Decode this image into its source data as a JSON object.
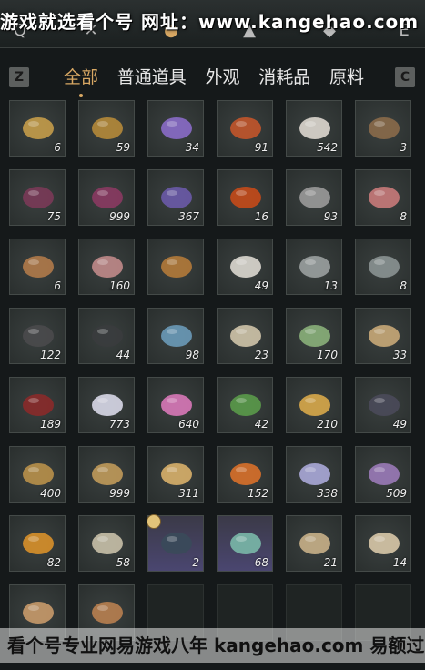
{
  "watermark_top": "游戏就选看个号   网址：www.kangehao.com",
  "watermark_bottom": "看个号专业网易游戏八年  kangehao.com  易额过百亿",
  "keys": {
    "left": "Z",
    "right": "C",
    "top_left": "Q",
    "top_right": "E"
  },
  "tabs": [
    {
      "label": "全部",
      "active": true
    },
    {
      "label": "普通道具",
      "active": false
    },
    {
      "label": "外观",
      "active": false
    },
    {
      "label": "消耗品",
      "active": false
    },
    {
      "label": "原料",
      "active": false
    }
  ],
  "items": [
    {
      "name": "fish-gold",
      "count": "6",
      "color": "#c49c4a"
    },
    {
      "name": "ore-gold",
      "count": "59",
      "color": "#b58a3a"
    },
    {
      "name": "crystal-purple",
      "count": "34",
      "color": "#8a6bc8"
    },
    {
      "name": "stone-red",
      "count": "91",
      "color": "#c2552b"
    },
    {
      "name": "herb-white",
      "count": "542",
      "color": "#ddd7cf"
    },
    {
      "name": "mortar-bowl",
      "count": "3",
      "color": "#8a6a4a"
    },
    {
      "name": "flower-purple",
      "count": "75",
      "color": "#7a3a58"
    },
    {
      "name": "flower-purple-2",
      "count": "999",
      "color": "#8a3a62"
    },
    {
      "name": "lavender",
      "count": "367",
      "color": "#6a5aa8"
    },
    {
      "name": "red-flower",
      "count": "16",
      "color": "#c44a1a"
    },
    {
      "name": "grass-gray",
      "count": "93",
      "color": "#9a9a9a"
    },
    {
      "name": "meat-slices",
      "count": "8",
      "color": "#c87a7a"
    },
    {
      "name": "bowl-soup",
      "count": "6",
      "color": "#b07a4a"
    },
    {
      "name": "meat-plate",
      "count": "160",
      "color": "#c08a8a"
    },
    {
      "name": "hide-brown",
      "count": "",
      "color": "#b27a3a"
    },
    {
      "name": "hide-white",
      "count": "49",
      "color": "#dcd8d0"
    },
    {
      "name": "fish-gray",
      "count": "13",
      "color": "#9aa0a0"
    },
    {
      "name": "fish-gray-2",
      "count": "8",
      "color": "#8a9292"
    },
    {
      "name": "ore-dark",
      "count": "122",
      "color": "#4a4a4c"
    },
    {
      "name": "ore-black",
      "count": "44",
      "color": "#3a3c3e"
    },
    {
      "name": "ore-blue",
      "count": "98",
      "color": "#6a9ab8"
    },
    {
      "name": "bone-spine",
      "count": "23",
      "color": "#cfc4aa"
    },
    {
      "name": "melon-green",
      "count": "170",
      "color": "#8ab07a"
    },
    {
      "name": "sacks",
      "count": "33",
      "color": "#c8a878"
    },
    {
      "name": "berry-bush",
      "count": "189",
      "color": "#8a2a2a"
    },
    {
      "name": "flower-white",
      "count": "773",
      "color": "#d8d8e8"
    },
    {
      "name": "flower-pink",
      "count": "640",
      "color": "#d878b8"
    },
    {
      "name": "herb-green",
      "count": "42",
      "color": "#5a9a4a"
    },
    {
      "name": "torch-herb",
      "count": "210",
      "color": "#d8a84a"
    },
    {
      "name": "feather-dark",
      "count": "49",
      "color": "#4a4a5a"
    },
    {
      "name": "shell-gold",
      "count": "400",
      "color": "#b8904a"
    },
    {
      "name": "shell-gold-2",
      "count": "999",
      "color": "#c09a5a"
    },
    {
      "name": "herb-roots",
      "count": "311",
      "color": "#d8b06a"
    },
    {
      "name": "stone-orange",
      "count": "152",
      "color": "#d8702a"
    },
    {
      "name": "flower-lilac",
      "count": "338",
      "color": "#aaa8d8"
    },
    {
      "name": "lavender-2",
      "count": "509",
      "color": "#9a7ab8"
    },
    {
      "name": "fruit-orange",
      "count": "82",
      "color": "#d8902a"
    },
    {
      "name": "radish-plant",
      "count": "58",
      "color": "#c8c0a8"
    },
    {
      "name": "giftbox-dark",
      "count": "2",
      "color": "#3a4a5a",
      "special": true
    },
    {
      "name": "giftbox-green",
      "count": "68",
      "color": "#7ab8a8",
      "special": true
    },
    {
      "name": "scroll-map",
      "count": "21",
      "color": "#c8b088"
    },
    {
      "name": "jar-ceramic",
      "count": "14",
      "color": "#d8c8a8"
    },
    {
      "name": "horn-1",
      "count": "",
      "color": "#c89a6a"
    },
    {
      "name": "horn-2",
      "count": "",
      "color": "#b88050"
    },
    {
      "name": "empty-1",
      "count": "",
      "color": "",
      "empty": true
    },
    {
      "name": "empty-2",
      "count": "",
      "color": "",
      "empty": true
    },
    {
      "name": "empty-3",
      "count": "",
      "color": "",
      "empty": true
    },
    {
      "name": "empty-4",
      "count": "",
      "color": "",
      "empty": true
    }
  ]
}
